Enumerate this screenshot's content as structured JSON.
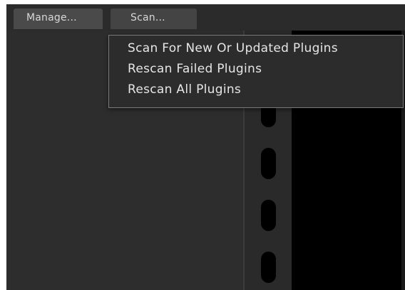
{
  "toolbar": {
    "manage_label": "Manage...",
    "scan_label": "Scan..."
  },
  "scan_menu": {
    "items": [
      {
        "label": "Scan For New Or Updated Plugins"
      },
      {
        "label": "Rescan Failed Plugins"
      },
      {
        "label": "Rescan All Plugins"
      }
    ]
  },
  "colors": {
    "window_bg": "#262626",
    "button_bg": "#4a4a4a",
    "menu_bg": "#2c2c2c",
    "menu_border": "#7a7a7a",
    "text": "#e6e6e6"
  }
}
